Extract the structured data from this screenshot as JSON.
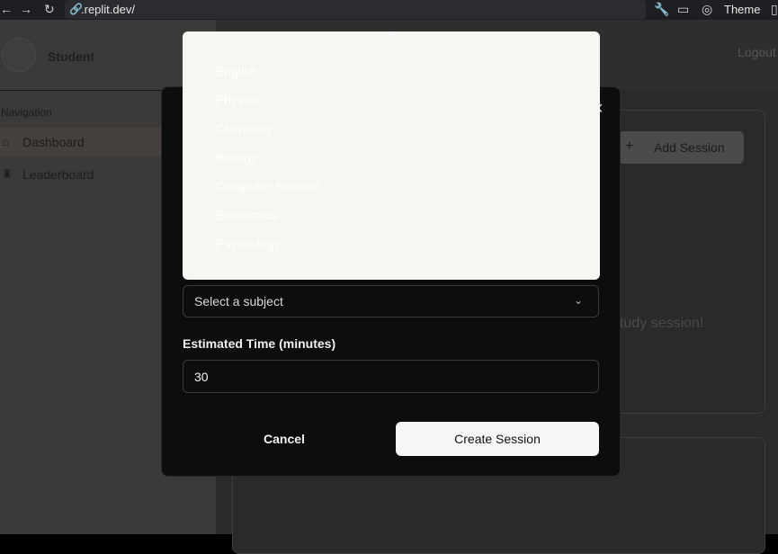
{
  "browser": {
    "url": ".replit.dev/",
    "theme_label": "Theme"
  },
  "sidebar": {
    "user_name": "Student",
    "nav_label": "Navigation",
    "items": [
      {
        "label": "Dashboard",
        "icon": "home-icon",
        "active": true
      },
      {
        "label": "Leaderboard",
        "icon": "trophy-icon",
        "active": false
      }
    ]
  },
  "header": {
    "logout_label": "Logout"
  },
  "main": {
    "add_session_label": "Add Session",
    "empty_message": "tudy session!"
  },
  "dialog": {
    "subject_placeholder": "Select a subject",
    "time_label": "Estimated Time (minutes)",
    "time_value": "30",
    "cancel_label": "Cancel",
    "create_label": "Create Session"
  },
  "dropdown": {
    "options": [
      "English",
      "Physics",
      "Chemistry",
      "Biology",
      "Computer Science",
      "Economics",
      "Psychology"
    ]
  }
}
